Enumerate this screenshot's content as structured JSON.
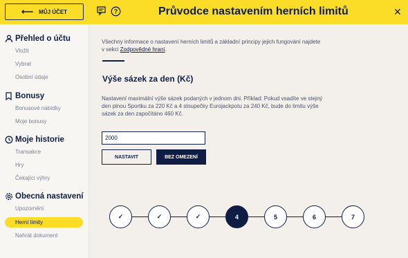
{
  "header": {
    "back_label": "MŮJ ÚČET",
    "title": "Průvodce nastavením herních limitů",
    "icons": [
      "chat-icon",
      "help-icon",
      "close-icon"
    ]
  },
  "sidebar": {
    "sections": [
      {
        "label": "Přehled o účtu",
        "icon": "user-icon",
        "items": [
          "Vložit",
          "Vybrat",
          "Osobní údaje"
        ]
      },
      {
        "label": "Bonusy",
        "icon": "bookmark-icon",
        "items": [
          "Bonusové nabídky",
          "Moje bonusy"
        ]
      },
      {
        "label": "Moje historie",
        "icon": "history-icon",
        "items": [
          "Transakce",
          "Hry",
          "Čekající výhry"
        ]
      },
      {
        "label": "Obecná nastavení",
        "icon": "gear-icon",
        "items": [
          "Upozornění",
          "Herní limity",
          "Nahrát dokument"
        ]
      }
    ],
    "active_item": "Herní limity"
  },
  "content": {
    "intro_text": "Všechny informace o nastavení herních limitů a základní principy jejich fungování najdete v sekci ",
    "intro_link": "Zodpovědné hraní",
    "intro_end": ".",
    "heading": "Výše sázek za den (Kč)",
    "description": "Nastavení maximální výše sázek podaných v jednom dni. Příklad: Pokud vsadíte ve stejný den plnou Sportku za 220 Kč a 4 sloupečky Eurojackpotu za 240 Kč, bude do limitu výše sázek za den započítáno 460 Kč.",
    "input_value": "2000",
    "btn_set": "NASTAVIT",
    "btn_unlimited": "BEZ OMEZENÍ"
  },
  "stepper": {
    "steps": [
      "✓",
      "✓",
      "✓",
      "4",
      "5",
      "6",
      "7"
    ],
    "current_step": 4,
    "colors": {
      "accent": "#fbdd27",
      "navy": "#0f1d45"
    }
  }
}
